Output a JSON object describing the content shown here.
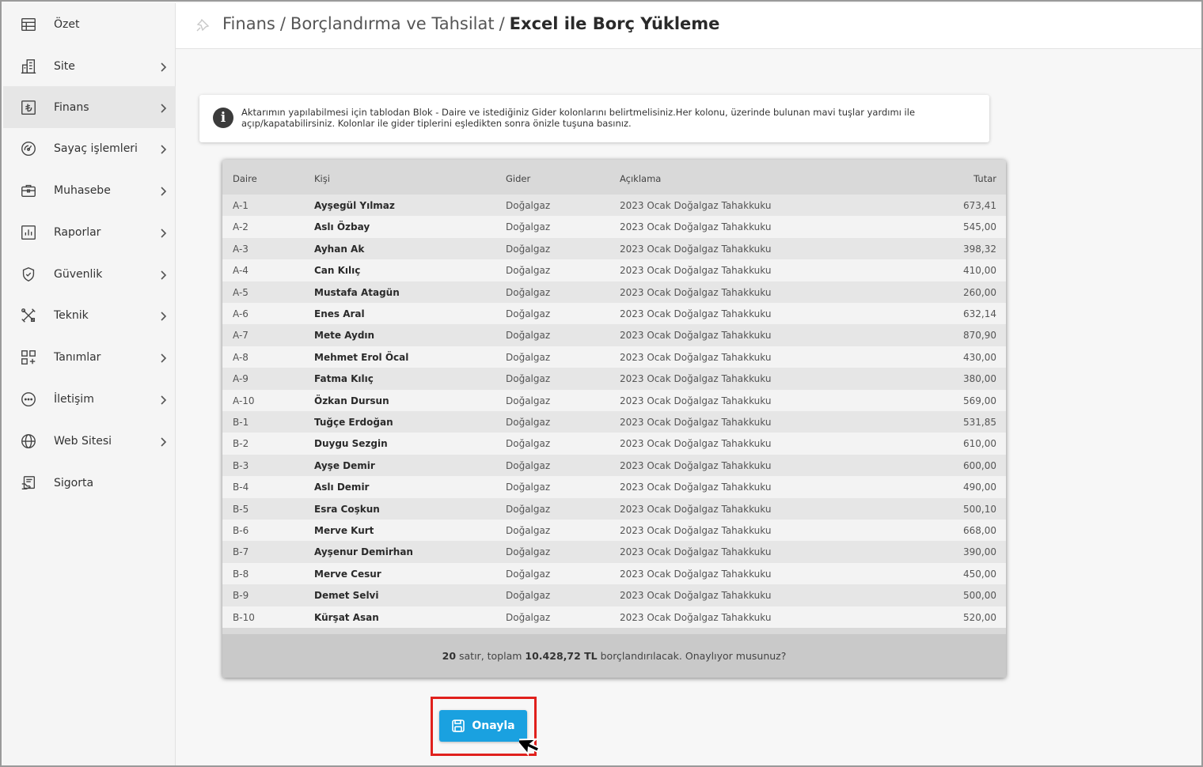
{
  "sidebar": {
    "items": [
      {
        "label": "Özet",
        "icon": "grid-table-icon",
        "chevron": false,
        "active": false
      },
      {
        "label": "Site",
        "icon": "building-icon",
        "chevron": true,
        "active": false
      },
      {
        "label": "Finans",
        "icon": "lira-icon",
        "chevron": true,
        "active": true
      },
      {
        "label": "Sayaç işlemleri",
        "icon": "gauge-icon",
        "chevron": true,
        "active": false
      },
      {
        "label": "Muhasebe",
        "icon": "briefcase-icon",
        "chevron": true,
        "active": false
      },
      {
        "label": "Raporlar",
        "icon": "bar-chart-icon",
        "chevron": true,
        "active": false
      },
      {
        "label": "Güvenlik",
        "icon": "shield-icon",
        "chevron": true,
        "active": false
      },
      {
        "label": "Teknik",
        "icon": "tools-icon",
        "chevron": true,
        "active": false
      },
      {
        "label": "Tanımlar",
        "icon": "apps-add-icon",
        "chevron": true,
        "active": false
      },
      {
        "label": "İletişim",
        "icon": "chat-icon",
        "chevron": true,
        "active": false
      },
      {
        "label": "Web Sitesi",
        "icon": "globe-icon",
        "chevron": true,
        "active": false
      },
      {
        "label": "Sigorta",
        "icon": "insurance-icon",
        "chevron": false,
        "active": false
      }
    ]
  },
  "breadcrumb": {
    "part1": "Finans",
    "part2": "Borçlandırma ve Tahsilat",
    "current": "Excel ile Borç Yükleme",
    "separator": "/"
  },
  "info": {
    "text": "Aktarımın yapılabilmesi için tablodan Blok - Daire ve istediğiniz Gider kolonlarını belirtmelisiniz.Her kolonu, üzerinde bulunan mavi tuşlar yardımı ile açıp/kapatabilirsiniz. Kolonlar ile gider tiplerini eşledikten sonra önizle tuşuna basınız."
  },
  "table": {
    "headers": {
      "daire": "Daire",
      "kisi": "Kişi",
      "gider": "Gider",
      "aciklama": "Açıklama",
      "tutar": "Tutar"
    },
    "rows": [
      {
        "daire": "A-1",
        "kisi": "Ayşegül Yılmaz",
        "gider": "Doğalgaz",
        "aciklama": "2023 Ocak Doğalgaz Tahakkuku",
        "tutar": "673,41"
      },
      {
        "daire": "A-2",
        "kisi": "Aslı Özbay",
        "gider": "Doğalgaz",
        "aciklama": "2023 Ocak Doğalgaz Tahakkuku",
        "tutar": "545,00"
      },
      {
        "daire": "A-3",
        "kisi": "Ayhan Ak",
        "gider": "Doğalgaz",
        "aciklama": "2023 Ocak Doğalgaz Tahakkuku",
        "tutar": "398,32"
      },
      {
        "daire": "A-4",
        "kisi": "Can Kılıç",
        "gider": "Doğalgaz",
        "aciklama": "2023 Ocak Doğalgaz Tahakkuku",
        "tutar": "410,00"
      },
      {
        "daire": "A-5",
        "kisi": "Mustafa Atagün",
        "gider": "Doğalgaz",
        "aciklama": "2023 Ocak Doğalgaz Tahakkuku",
        "tutar": "260,00"
      },
      {
        "daire": "A-6",
        "kisi": "Enes Aral",
        "gider": "Doğalgaz",
        "aciklama": "2023 Ocak Doğalgaz Tahakkuku",
        "tutar": "632,14"
      },
      {
        "daire": "A-7",
        "kisi": "Mete Aydın",
        "gider": "Doğalgaz",
        "aciklama": "2023 Ocak Doğalgaz Tahakkuku",
        "tutar": "870,90"
      },
      {
        "daire": "A-8",
        "kisi": "Mehmet Erol Öcal",
        "gider": "Doğalgaz",
        "aciklama": "2023 Ocak Doğalgaz Tahakkuku",
        "tutar": "430,00"
      },
      {
        "daire": "A-9",
        "kisi": "Fatma Kılıç",
        "gider": "Doğalgaz",
        "aciklama": "2023 Ocak Doğalgaz Tahakkuku",
        "tutar": "380,00"
      },
      {
        "daire": "A-10",
        "kisi": "Özkan Dursun",
        "gider": "Doğalgaz",
        "aciklama": "2023 Ocak Doğalgaz Tahakkuku",
        "tutar": "569,00"
      },
      {
        "daire": "B-1",
        "kisi": "Tuğçe Erdoğan",
        "gider": "Doğalgaz",
        "aciklama": "2023 Ocak Doğalgaz Tahakkuku",
        "tutar": "531,85"
      },
      {
        "daire": "B-2",
        "kisi": "Duygu Sezgin",
        "gider": "Doğalgaz",
        "aciklama": "2023 Ocak Doğalgaz Tahakkuku",
        "tutar": "610,00"
      },
      {
        "daire": "B-3",
        "kisi": "Ayşe Demir",
        "gider": "Doğalgaz",
        "aciklama": "2023 Ocak Doğalgaz Tahakkuku",
        "tutar": "600,00"
      },
      {
        "daire": "B-4",
        "kisi": "Aslı Demir",
        "gider": "Doğalgaz",
        "aciklama": "2023 Ocak Doğalgaz Tahakkuku",
        "tutar": "490,00"
      },
      {
        "daire": "B-5",
        "kisi": "Esra Coşkun",
        "gider": "Doğalgaz",
        "aciklama": "2023 Ocak Doğalgaz Tahakkuku",
        "tutar": "500,10"
      },
      {
        "daire": "B-6",
        "kisi": "Merve Kurt",
        "gider": "Doğalgaz",
        "aciklama": "2023 Ocak Doğalgaz Tahakkuku",
        "tutar": "668,00"
      },
      {
        "daire": "B-7",
        "kisi": "Ayşenur Demirhan",
        "gider": "Doğalgaz",
        "aciklama": "2023 Ocak Doğalgaz Tahakkuku",
        "tutar": "390,00"
      },
      {
        "daire": "B-8",
        "kisi": "Merve Cesur",
        "gider": "Doğalgaz",
        "aciklama": "2023 Ocak Doğalgaz Tahakkuku",
        "tutar": "450,00"
      },
      {
        "daire": "B-9",
        "kisi": "Demet Selvi",
        "gider": "Doğalgaz",
        "aciklama": "2023 Ocak Doğalgaz Tahakkuku",
        "tutar": "500,00"
      },
      {
        "daire": "B-10",
        "kisi": "Kürşat Asan",
        "gider": "Doğalgaz",
        "aciklama": "2023 Ocak Doğalgaz Tahakkuku",
        "tutar": "520,00"
      }
    ],
    "footer": {
      "row_count": "20",
      "text1": " satır, toplam ",
      "total": "10.428,72 TL",
      "text2": " borçlandırılacak. Onaylıyor musunuz?"
    }
  },
  "confirm_button": {
    "label": "Onayla",
    "icon": "save-icon"
  },
  "colors": {
    "accent": "#1aa1e0",
    "highlight": "#e0201c",
    "active_nav": "#e6e6e6"
  }
}
